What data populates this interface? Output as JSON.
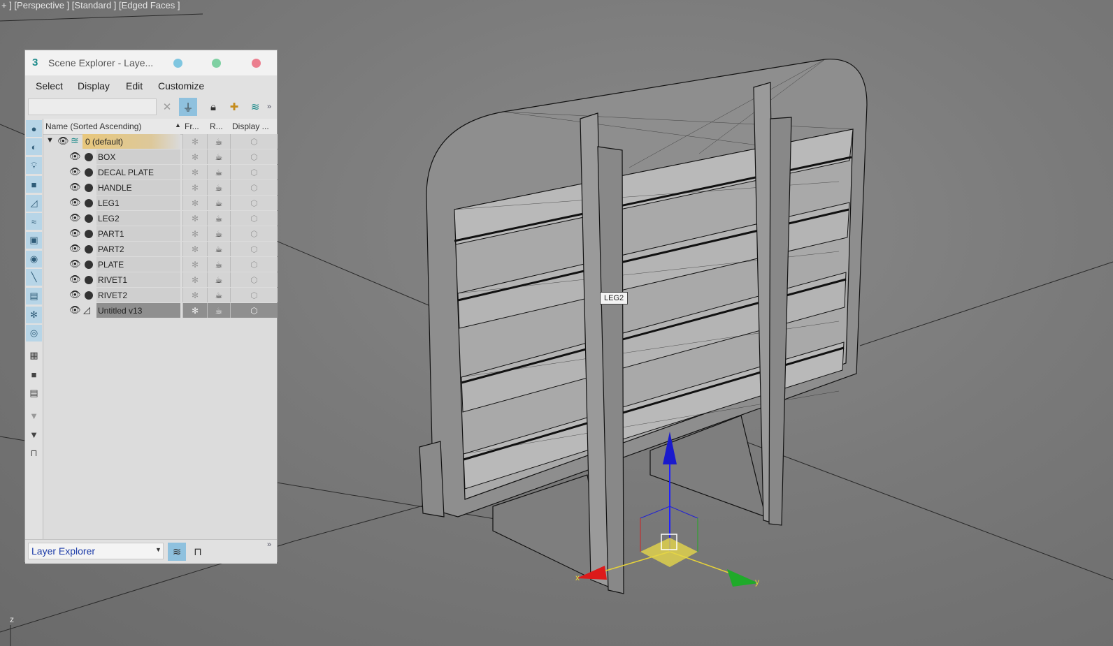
{
  "viewport": {
    "label": "+ ] [Perspective ] [Standard ] [Edged Faces ]",
    "tooltip": "LEG2",
    "axis_z": "z",
    "axis_y": "y",
    "axis_x": "x"
  },
  "explorer": {
    "title": "Scene Explorer - Laye...",
    "menu": [
      "Select",
      "Display",
      "Edit",
      "Customize"
    ],
    "search": {
      "value": ""
    },
    "columns": {
      "name": "Name (Sorted Ascending)",
      "frozen": "Fr...",
      "render": "R...",
      "display": "Display ..."
    },
    "root_layer": "0 (default)",
    "objects": [
      "BOX",
      "DECAL PLATE",
      "HANDLE",
      "LEG1",
      "LEG2",
      "PART1",
      "PART2",
      "PLATE",
      "RIVET1",
      "RIVET2"
    ],
    "selected_object": "Untitled v13",
    "bottom_dropdown": "Layer Explorer",
    "colors": {
      "selected_row": "#8f8f8f",
      "layer_highlight": "#e8c77b",
      "accent": "#1b8a8a"
    }
  }
}
